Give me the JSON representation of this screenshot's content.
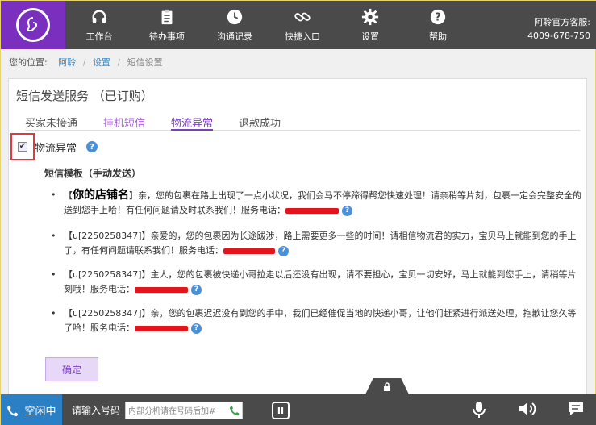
{
  "header": {
    "nav": [
      {
        "label": "工作台",
        "icon": "headset-icon"
      },
      {
        "label": "待办事项",
        "icon": "clipboard-icon"
      },
      {
        "label": "沟通记录",
        "icon": "clock-icon"
      },
      {
        "label": "快捷入口",
        "icon": "link-icon"
      },
      {
        "label": "设置",
        "icon": "gear-icon"
      },
      {
        "label": "帮助",
        "icon": "question-icon"
      }
    ],
    "hotline_label": "阿聆官方客服:",
    "hotline_number": "4009-678-750"
  },
  "breadcrumb": {
    "prefix": "您的位置:",
    "items": [
      "阿聆",
      "设置",
      "短信设置"
    ]
  },
  "panel": {
    "title": "短信发送服务 （已订购）",
    "tabs": [
      "买家未接通",
      "挂机短信",
      "物流异常",
      "退款成功"
    ],
    "active_tab": "物流异常",
    "checkbox_label": "物流异常",
    "checkbox_checked": true,
    "template_title": "短信模板（手动发送）",
    "messages": [
      {
        "prefix": "【",
        "shop": "你的店铺名",
        "body": "】亲，您的包裹在路上出现了一点小状况，我们会马不停蹄得帮您快速处理！请亲稍等片刻，包裹一定会完整安全的送到您手上哈！有任何问题请及时联系我们！服务电话："
      },
      {
        "prefix": "【u[2250258347]】",
        "shop": "",
        "body": "亲爱的，您的包裹因为长途跋涉，路上需要更多一些的时间！请相信物流君的实力，宝贝马上就能到您的手上了，有任何问题请联系我们！服务电话："
      },
      {
        "prefix": "【u[2250258347]】",
        "shop": "",
        "body": "主人，您的包裹被快递小哥拉走以后还没有出现，请不要担心，宝贝一切安好，马上就能到您手上，请稍等片刻哦！服务电话："
      },
      {
        "prefix": "【u[2250258347]】",
        "shop": "",
        "body": "亲，您的包裹迟迟没有到您的手中，我们已经催促当地的快递小哥，让他们赶紧进行派送处理，抱歉让您久等了哈！服务电话："
      }
    ],
    "confirm_label": "确定"
  },
  "bottom_bar": {
    "status": "空闲中",
    "dial_label": "请输入号码",
    "dial_placeholder": "内部分机请在号码后加#",
    "pause_label": "II"
  },
  "colors": {
    "header_bg": "#4a4a4a",
    "brand_purple": "#7b2fbf",
    "status_blue": "#2b7fc4",
    "redaction": "#e3141b"
  }
}
